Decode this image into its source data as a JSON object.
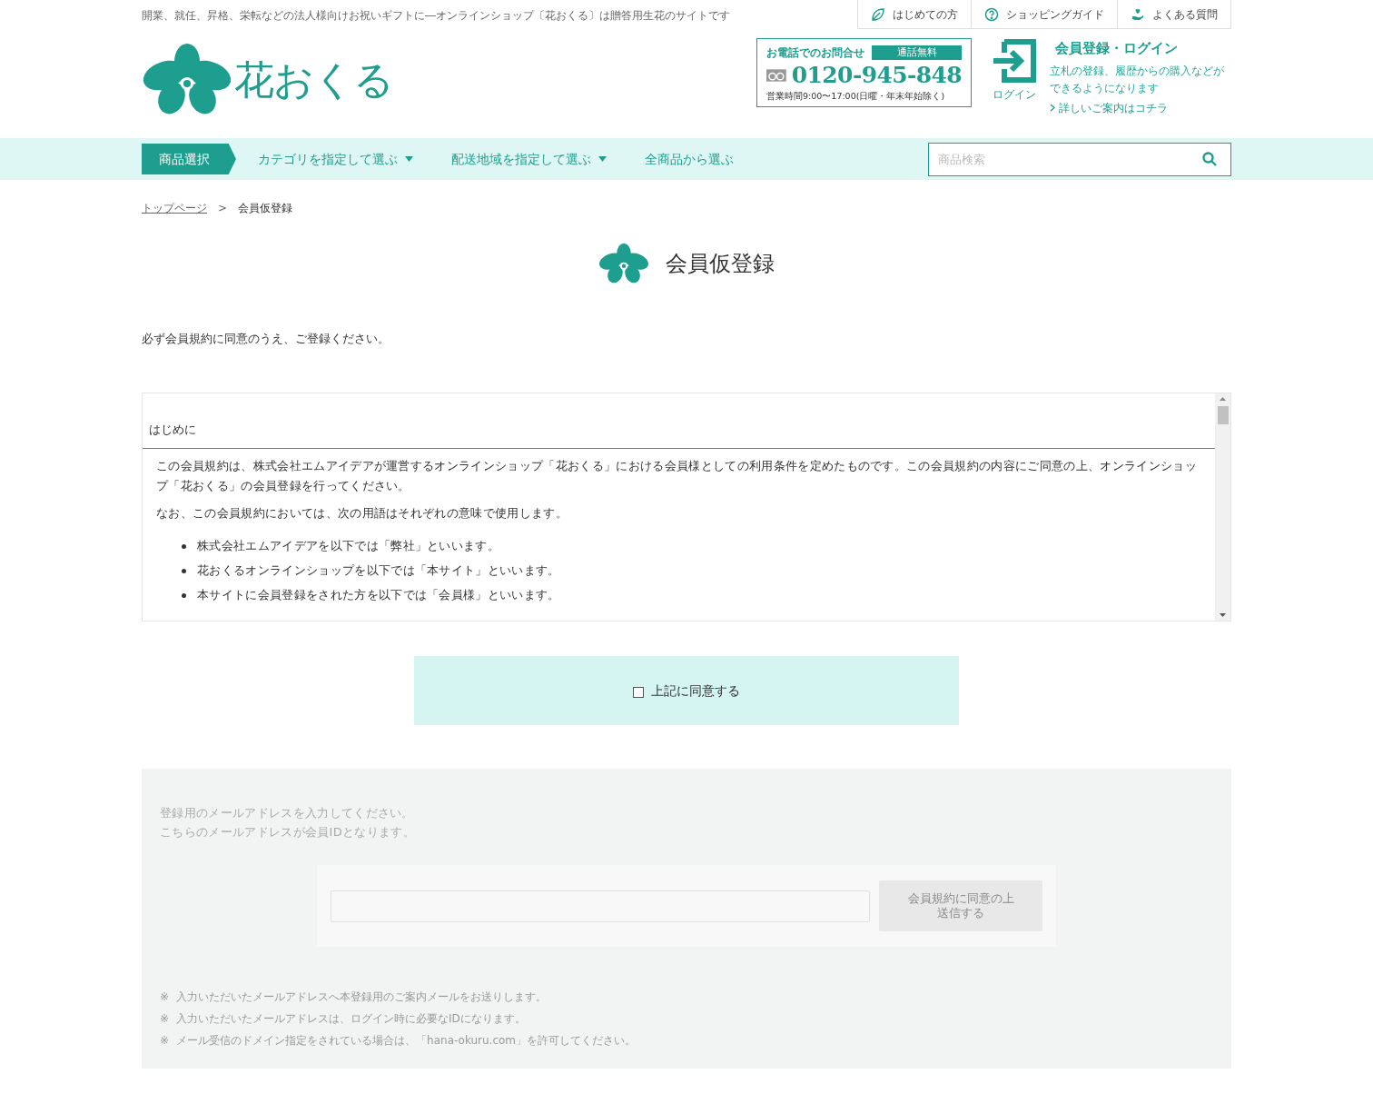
{
  "header": {
    "tagline": "開業、就任、昇格、栄転などの法人様向けお祝いギフトに―オンラインショップ〔花おくる〕は贈答用生花のサイトです",
    "top_links": [
      {
        "kind": "leaf",
        "label": "はじめての方"
      },
      {
        "kind": "question",
        "label": "ショッピングガイド"
      },
      {
        "kind": "care",
        "label": "よくある質問"
      }
    ],
    "logo": "花おくる",
    "phone": {
      "title": "お電話でのお問合せ",
      "badge": "通話無料",
      "number": "0120-945-848",
      "hours": "営業時間9:00〜17:00(日曜・年末年始除く)"
    },
    "login": {
      "icon_label": "ログイン",
      "title": "会員登録・ログイン",
      "description": "立札の登録、履歴からの購入などができるようになります",
      "link": "詳しいご案内はコチラ"
    }
  },
  "nav": {
    "items": [
      {
        "label": "商品選択",
        "selected": true,
        "dropdown": false
      },
      {
        "label": "カテゴリを指定して選ぶ",
        "selected": false,
        "dropdown": true
      },
      {
        "label": "配送地域を指定して選ぶ",
        "selected": false,
        "dropdown": true
      },
      {
        "label": "全商品から選ぶ",
        "selected": false,
        "dropdown": false
      }
    ],
    "search": {
      "placeholder": "商品検索"
    }
  },
  "breadcrumb": [
    {
      "label": "トップページ",
      "link": true
    },
    {
      "label": "会員仮登録",
      "link": false
    }
  ],
  "breadcrumb_separator": ">",
  "page_title": "会員仮登録",
  "intro": "必ず会員規約に同意のうえ、ご登録ください。",
  "terms": {
    "heading": "はじめに",
    "paragraphs": [
      "この会員規約は、株式会社エムアイデアが運営するオンラインショップ「花おくる」における会員様としての利用条件を定めたものです。この会員規約の内容にご同意の上、オンラインショップ「花おくる」の会員登録を行ってください。",
      "なお、この会員規約においては、次の用語はそれぞれの意味で使用します。"
    ],
    "bullets": [
      "株式会社エムアイデアを以下では「弊社」といいます。",
      "花おくるオンラインショップを以下では「本サイト」といいます。",
      "本サイトに会員登録をされた方を以下では「会員様」といいます。"
    ]
  },
  "agree": {
    "label": "上記に同意する",
    "checked": false
  },
  "email_form": {
    "disabled": true,
    "instructions": [
      "登録用のメールアドレスを入力してください。",
      "こちらのメールアドレスが会員IDとなります。"
    ],
    "submit_lines": [
      "会員規約に同意の上",
      "送信する"
    ],
    "notes": [
      {
        "mark": "※",
        "text": "入力いただいたメールアドレスへ本登録用のご案内メールをお送りします。"
      },
      {
        "mark": "※",
        "text": "入力いただいたメールアドレスは、ログイン時に必要なIDになります。"
      },
      {
        "mark": "※",
        "text": "メール受信のドメイン指定をされている場合は、「hana-okuru.com」を許可してください。"
      }
    ]
  }
}
